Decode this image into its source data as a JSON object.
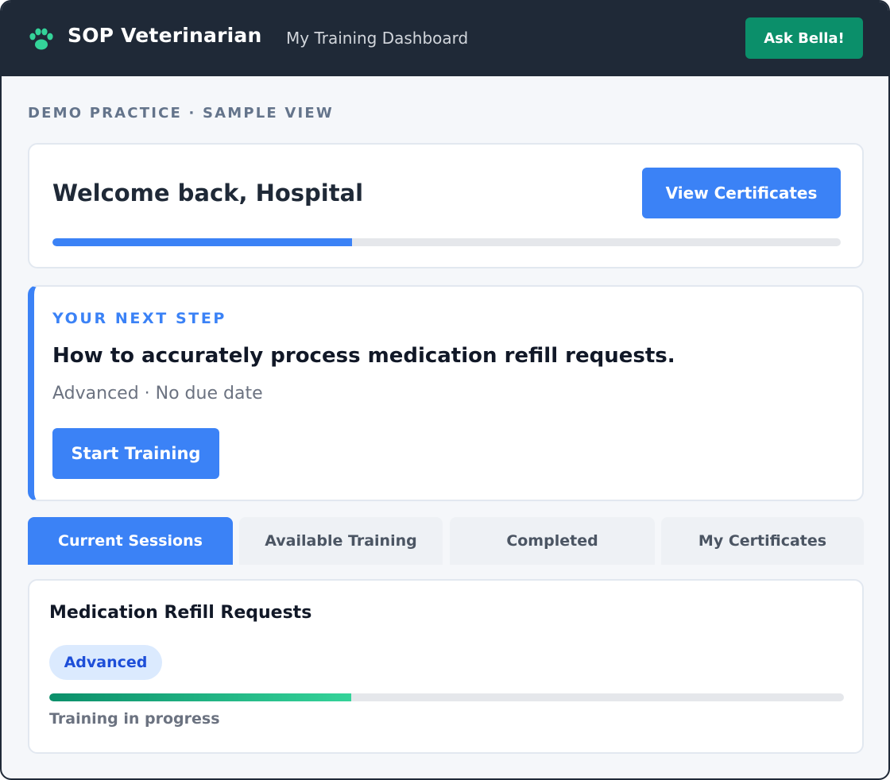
{
  "header": {
    "brand": "SOP Veterinarian",
    "subtitle": "My Training Dashboard",
    "ask_button": "Ask Bella!",
    "icon": "paw-icon",
    "background_color": "#1f2937",
    "accent_color": "#0b8f6a"
  },
  "context_label": "DEMO PRACTICE · SAMPLE VIEW",
  "welcome": {
    "title": "Welcome back, Hospital",
    "certificates_button": "View Certificates",
    "progress": 0.38
  },
  "next_step": {
    "label": "YOUR NEXT STEP",
    "title": "How to accurately process medication refill requests.",
    "meta": "Advanced · No due date",
    "start_button": "Start Training"
  },
  "tabs": [
    {
      "label": "Current Sessions",
      "active": true
    },
    {
      "label": "Available Training",
      "active": false
    },
    {
      "label": "Completed",
      "active": false
    },
    {
      "label": "My Certificates",
      "active": false
    }
  ],
  "session": {
    "title": "Medication Refill Requests",
    "badge": "Advanced",
    "progress": 0.38,
    "status": "Training in progress"
  },
  "colors": {
    "primary": "#3b82f6",
    "success": "#0b8f6a",
    "page_background": "#f5f7fa"
  }
}
